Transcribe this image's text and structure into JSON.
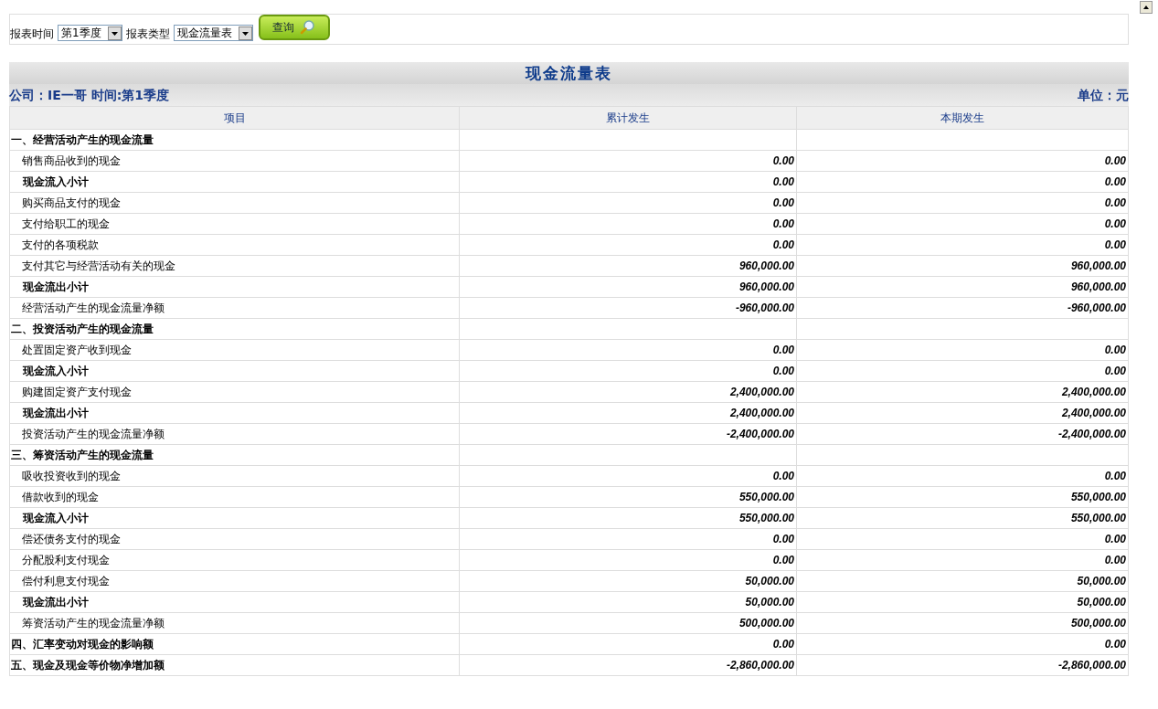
{
  "toolbar": {
    "fields": [
      {
        "label": "报表时间",
        "value": "第1季度"
      },
      {
        "label": "报表类型",
        "value": "现金流量表"
      }
    ],
    "button": "查询"
  },
  "report": {
    "title": "现金流量表",
    "company": "公司：IE一哥  时间:第1季度",
    "unit": "单位：元",
    "columns": [
      "项目",
      "累计发生",
      "本期发生"
    ],
    "rows": [
      {
        "kind": "section",
        "label": "一、经营活动产生的现金流量"
      },
      {
        "kind": "item",
        "label": "销售商品收到的现金",
        "values": [
          "0.00",
          "0.00"
        ]
      },
      {
        "kind": "subtotal",
        "label": "现金流入小计",
        "values": [
          "0.00",
          "0.00"
        ]
      },
      {
        "kind": "item",
        "label": "购买商品支付的现金",
        "values": [
          "0.00",
          "0.00"
        ]
      },
      {
        "kind": "item",
        "label": "支付给职工的现金",
        "values": [
          "0.00",
          "0.00"
        ]
      },
      {
        "kind": "item",
        "label": "支付的各项税款",
        "values": [
          "0.00",
          "0.00"
        ]
      },
      {
        "kind": "item",
        "label": "支付其它与经营活动有关的现金",
        "values": [
          "960,000.00",
          "960,000.00"
        ]
      },
      {
        "kind": "subtotal",
        "label": "现金流出小计",
        "values": [
          "960,000.00",
          "960,000.00"
        ]
      },
      {
        "kind": "item",
        "label": "经营活动产生的现金流量净额",
        "values": [
          "-960,000.00",
          "-960,000.00"
        ]
      },
      {
        "kind": "section",
        "label": "二、投资活动产生的现金流量"
      },
      {
        "kind": "item",
        "label": "处置固定资产收到现金",
        "values": [
          "0.00",
          "0.00"
        ]
      },
      {
        "kind": "subtotal",
        "label": "现金流入小计",
        "values": [
          "0.00",
          "0.00"
        ]
      },
      {
        "kind": "item",
        "label": "购建固定资产支付现金",
        "values": [
          "2,400,000.00",
          "2,400,000.00"
        ]
      },
      {
        "kind": "subtotal",
        "label": "现金流出小计",
        "values": [
          "2,400,000.00",
          "2,400,000.00"
        ]
      },
      {
        "kind": "item",
        "label": "投资活动产生的现金流量净额",
        "values": [
          "-2,400,000.00",
          "-2,400,000.00"
        ]
      },
      {
        "kind": "section",
        "label": "三、筹资活动产生的现金流量"
      },
      {
        "kind": "item",
        "label": "吸收投资收到的现金",
        "values": [
          "0.00",
          "0.00"
        ]
      },
      {
        "kind": "item",
        "label": "借款收到的现金",
        "values": [
          "550,000.00",
          "550,000.00"
        ]
      },
      {
        "kind": "subtotal",
        "label": "现金流入小计",
        "values": [
          "550,000.00",
          "550,000.00"
        ]
      },
      {
        "kind": "item",
        "label": "偿还债务支付的现金",
        "values": [
          "0.00",
          "0.00"
        ]
      },
      {
        "kind": "item",
        "label": "分配股利支付现金",
        "values": [
          "0.00",
          "0.00"
        ]
      },
      {
        "kind": "item",
        "label": "偿付利息支付现金",
        "values": [
          "50,000.00",
          "50,000.00"
        ]
      },
      {
        "kind": "subtotal",
        "label": "现金流出小计",
        "values": [
          "50,000.00",
          "50,000.00"
        ]
      },
      {
        "kind": "item",
        "label": "筹资活动产生的现金流量净额",
        "values": [
          "500,000.00",
          "500,000.00"
        ]
      },
      {
        "kind": "section",
        "label": "四、汇率变动对现金的影响额",
        "values": [
          "0.00",
          "0.00"
        ]
      },
      {
        "kind": "section",
        "label": "五、现金及现金等价物净增加额",
        "values": [
          "-2,860,000.00",
          "-2,860,000.00"
        ]
      }
    ]
  }
}
